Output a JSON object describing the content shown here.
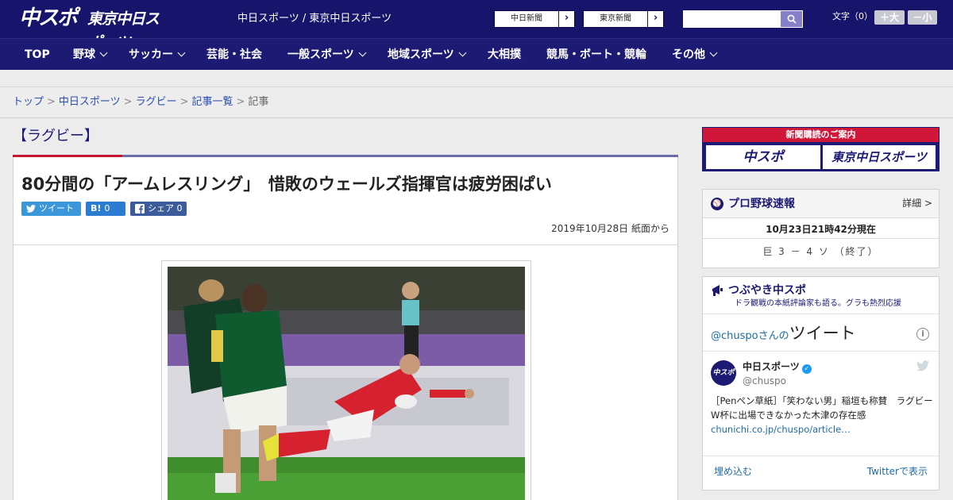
{
  "header": {
    "logo_chuspo": "中スポ",
    "logo_tokyo": "東京中日スポーツ",
    "site_name": "中日スポーツ / 東京中日スポーツ",
    "paper_links": [
      {
        "label": "中日新聞",
        "arrow": "›"
      },
      {
        "label": "東京新聞",
        "arrow": "›"
      }
    ],
    "search": {
      "value": "",
      "placeholder": ""
    },
    "font_size_label": "文字（0）",
    "font_bigger": "＋大",
    "font_smaller": "－小"
  },
  "nav": {
    "items": [
      {
        "label": "TOP",
        "has_dropdown": false
      },
      {
        "label": "野球",
        "has_dropdown": true
      },
      {
        "label": "サッカー",
        "has_dropdown": true
      },
      {
        "label": "芸能・社会",
        "has_dropdown": false
      },
      {
        "label": "一般スポーツ",
        "has_dropdown": true
      },
      {
        "label": "地域スポーツ",
        "has_dropdown": true
      },
      {
        "label": "大相撲",
        "has_dropdown": false
      },
      {
        "label": "競馬・ボート・競輪",
        "has_dropdown": false
      },
      {
        "label": "その他",
        "has_dropdown": true
      }
    ]
  },
  "breadcrumb": {
    "items": [
      "トップ",
      "中日スポーツ",
      "ラグビー",
      "記事一覧"
    ],
    "current": "記事",
    "separator": ">"
  },
  "article": {
    "section": "【ラグビー】",
    "headline": "80分間の「アームレスリング」　惜敗のウェールズ指揮官は疲労困ぱい",
    "share": {
      "tweet_label": "ツイート",
      "hatena_label": "B!",
      "hatena_count": "0",
      "facebook_label": "シェア",
      "facebook_count": "0"
    },
    "dateline": "2019年10月28日 紙面から"
  },
  "sidebar": {
    "subscription": {
      "banner_text": "新聞購読のご案内",
      "logo1": "中スポ",
      "logo2": "東京中日スポーツ"
    },
    "baseball": {
      "title": "プロ野球速報",
      "detail_link": "詳細 >",
      "time": "10月23日21時42分現在",
      "score": "巨 3 － 4 ソ （終了）"
    },
    "tweets": {
      "title": "つぶやき中スポ",
      "subtitle": "ドラ観戦の本紙評論家も語る。グラも熱烈応援",
      "handle_prefix": "@chuspo",
      "handle_suffix": "さんの",
      "handle_big": "ツイート",
      "account_name": "中日スポーツ",
      "account_at": "@chuspo",
      "tweet_text": "［Penペン草紙］「笑わない男」稲垣も称賛　ラグビーW杯に出場できなかった木津の存在感",
      "tweet_link": "chunichi.co.jp/chuspo/article…",
      "embed_label": "埋め込む",
      "view_label": "Twitterで表示"
    }
  },
  "colors": {
    "header_bg": "#16156b",
    "nav_bg": "#1c1a73",
    "accent_red": "#c6162e",
    "link_blue": "#2a4eb1"
  }
}
